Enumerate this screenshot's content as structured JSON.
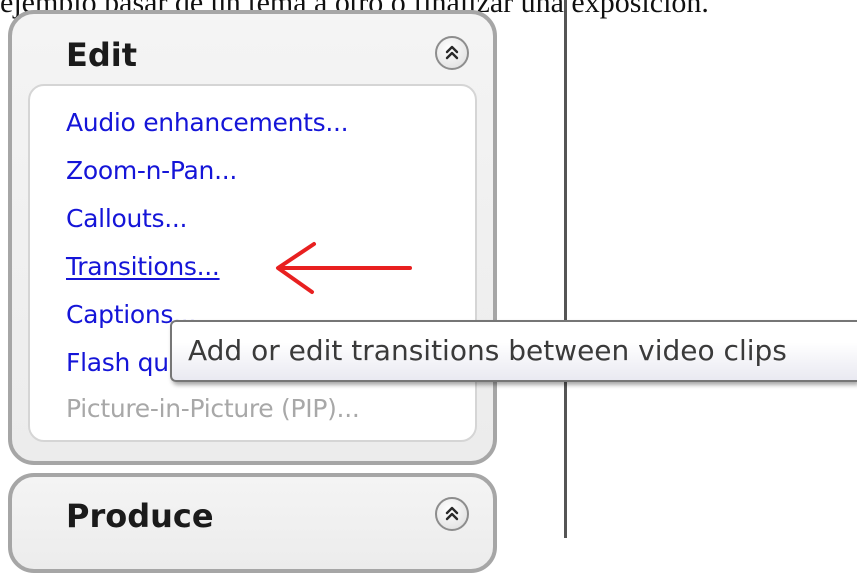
{
  "document": {
    "caption_text": "ejemplo pasar de un tema a otro o finalizar una exposición."
  },
  "edit_panel": {
    "title": "Edit",
    "collapse_icon": "double-chevron-up-icon",
    "items": [
      {
        "label": "Audio enhancements...",
        "state": "enabled"
      },
      {
        "label": "Zoom-n-Pan...",
        "state": "enabled"
      },
      {
        "label": "Callouts...",
        "state": "enabled"
      },
      {
        "label": "Transitions...",
        "state": "hovered"
      },
      {
        "label": "Captions...",
        "state": "enabled"
      },
      {
        "label": "Flash quiz and survey...",
        "state": "enabled"
      },
      {
        "label": "Picture-in-Picture (PIP)...",
        "state": "disabled"
      }
    ]
  },
  "produce_panel": {
    "title": "Produce",
    "collapse_icon": "double-chevron-up-icon"
  },
  "tooltip": {
    "text": "Add or edit transitions between video clips"
  },
  "annotation": {
    "arrow_icon": "left-arrow-icon",
    "arrow_color": "#e82020"
  },
  "colors": {
    "link": "#1515d8",
    "disabled": "#a8a8a8",
    "panel_border": "#a6a6a6",
    "divider": "#555555"
  }
}
